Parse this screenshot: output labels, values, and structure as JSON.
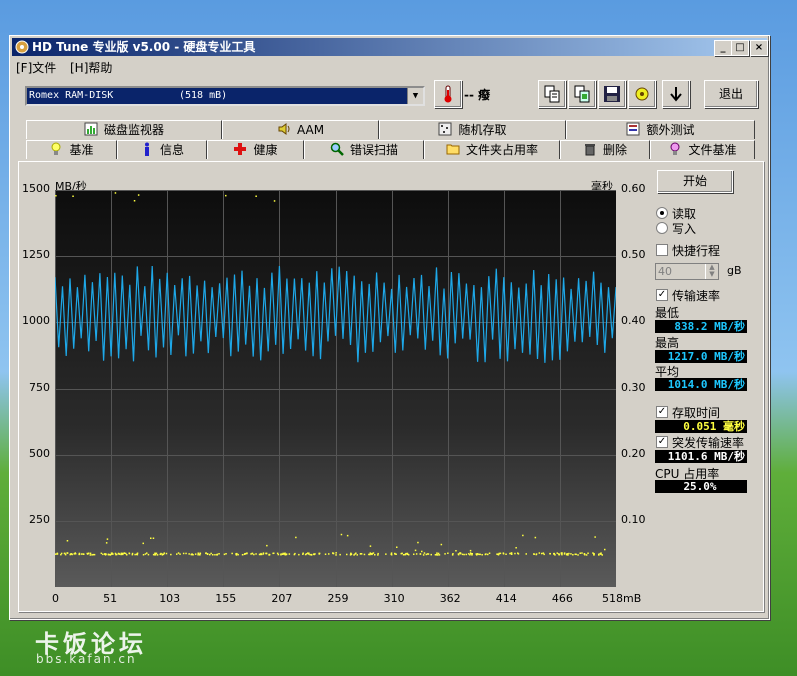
{
  "window": {
    "title": "HD Tune 专业版 v5.00 - 硬盘专业工具",
    "buttons": {
      "minimize": "_",
      "maximize": "□",
      "close": "×"
    }
  },
  "menu": {
    "file": "[F]文件",
    "help": "[H]帮助"
  },
  "toolbar": {
    "drive_name": "Romex   RAM-DISK",
    "drive_size": "(518 mB)",
    "temperature": "-- 癈",
    "exit_label": "退出"
  },
  "tabs_top": [
    {
      "label": "磁盘监视器",
      "icon": "disk-monitor-icon"
    },
    {
      "label": "AAM",
      "icon": "speaker-icon"
    },
    {
      "label": "随机存取",
      "icon": "random-access-icon"
    },
    {
      "label": "额外测试",
      "icon": "extra-tests-icon"
    }
  ],
  "tabs_bottom": [
    {
      "label": "基准",
      "icon": "lightbulb-icon",
      "active": true
    },
    {
      "label": "信息",
      "icon": "info-icon"
    },
    {
      "label": "健康",
      "icon": "health-cross-icon"
    },
    {
      "label": "错误扫描",
      "icon": "magnifier-icon"
    },
    {
      "label": "文件夹占用率",
      "icon": "folder-icon"
    },
    {
      "label": "删除",
      "icon": "trash-icon"
    },
    {
      "label": "文件基准",
      "icon": "file-benchmark-icon"
    }
  ],
  "controls": {
    "start_label": "开始",
    "read_label": "读取",
    "write_label": "写入",
    "mode": "read",
    "quick_label": "快捷行程",
    "quick_checked": false,
    "quick_value": "40",
    "quick_unit": "gB",
    "transfer_label": "传输速率",
    "transfer_checked": true,
    "min_label": "最低",
    "min_value": "838.2 MB/秒",
    "max_label": "最高",
    "max_value": "1217.0 MB/秒",
    "avg_label": "平均",
    "avg_value": "1014.0 MB/秒",
    "access_label": "存取时间",
    "access_checked": true,
    "access_value": "0.051 毫秒",
    "burst_label": "突发传输速率",
    "burst_checked": true,
    "burst_value": "1101.6 MB/秒",
    "cpu_label": "CPU 占用率",
    "cpu_value": "25.0%"
  },
  "colors": {
    "transfer_line": "#1ea8e8",
    "access_points": "#ffff40",
    "value_text": "#1ec8ff",
    "access_value_text": "#ffff40"
  },
  "chart_data": {
    "type": "line",
    "y_left_label": "MB/秒",
    "y_right_label": "毫秒",
    "y_left_ticks": [
      "1500",
      "1250",
      "1000",
      "750",
      "500",
      "250"
    ],
    "y_right_ticks": [
      "0.60",
      "0.50",
      "0.40",
      "0.30",
      "0.20",
      "0.10"
    ],
    "x_ticks": [
      "0",
      "51",
      "103",
      "155",
      "207",
      "259",
      "310",
      "362",
      "414",
      "466",
      "518mB"
    ],
    "ylim_left": [
      0,
      1500
    ],
    "ylim_right": [
      0,
      0.6
    ],
    "xlim": [
      0,
      518
    ],
    "grid": true,
    "series": [
      {
        "axis": "left",
        "style": "line",
        "summary": {
          "min": 838.2,
          "max": 1217.0,
          "avg": 1014.0
        }
      },
      {
        "axis": "right",
        "style": "points",
        "summary": {
          "avg": 0.051
        }
      }
    ]
  },
  "watermark": {
    "brand": "卡饭论坛",
    "url": "bbs.kafan.cn"
  }
}
